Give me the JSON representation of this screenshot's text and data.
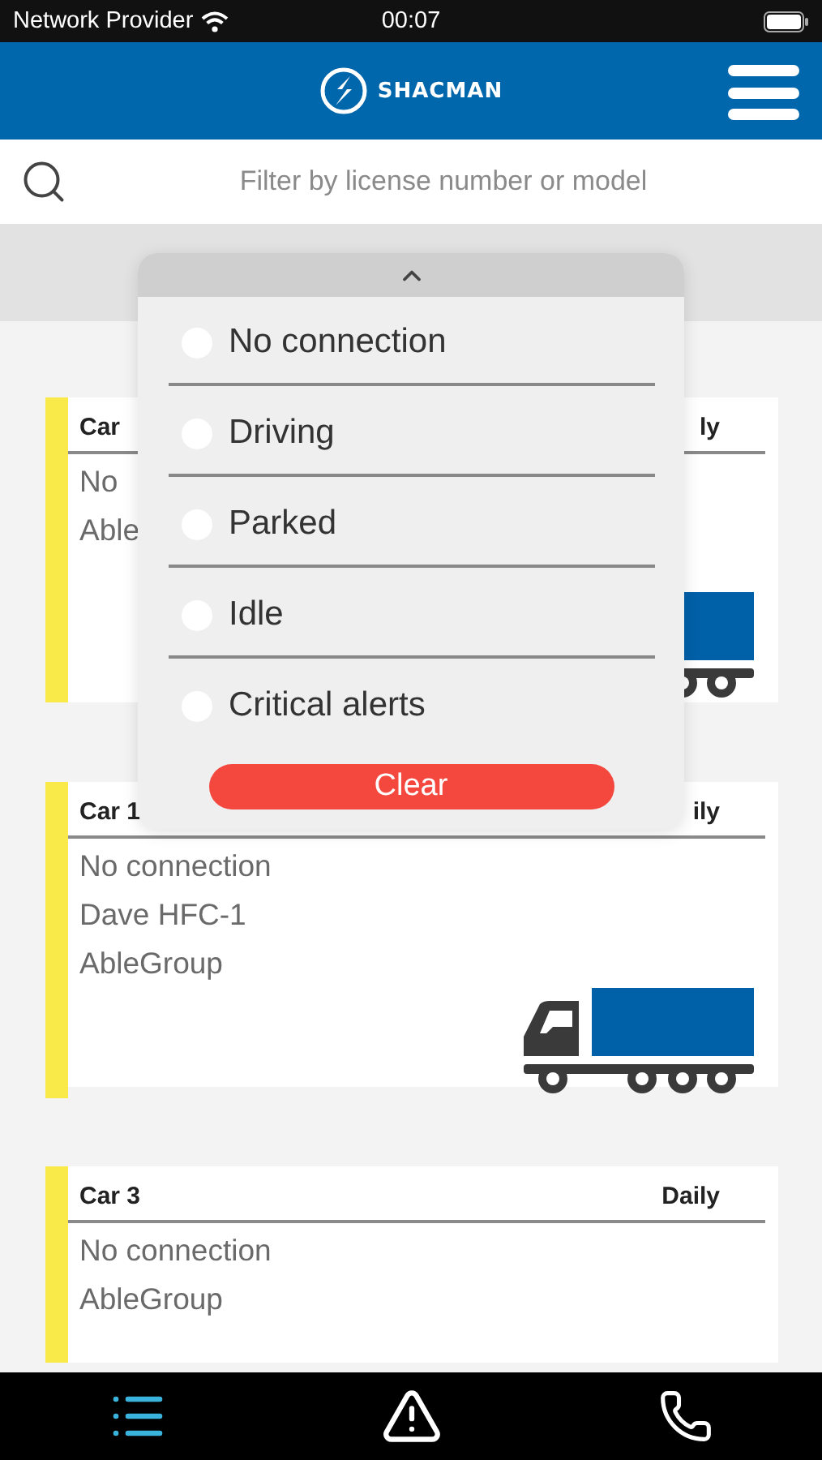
{
  "status_bar": {
    "carrier": "Network Provider",
    "time": "00:07"
  },
  "header": {
    "logo_text": "SHACMAN"
  },
  "search": {
    "placeholder": "Filter by license number or model"
  },
  "cards": [
    {
      "title": "Car",
      "period": "ly",
      "lines": [
        "No",
        "Able"
      ]
    },
    {
      "title": "Car 1",
      "period": "ily",
      "lines": [
        "No connection",
        "Dave HFC-1",
        "AbleGroup"
      ]
    },
    {
      "title": "Car 3",
      "period": "Daily",
      "lines": [
        "No connection",
        "AbleGroup"
      ]
    }
  ],
  "filter_menu": {
    "options": [
      {
        "label": "No connection",
        "selected": false
      },
      {
        "label": "Driving",
        "selected": false
      },
      {
        "label": "Parked",
        "selected": false
      },
      {
        "label": "Idle",
        "selected": false
      },
      {
        "label": "Critical alerts",
        "selected": false
      }
    ],
    "clear_label": "Clear"
  },
  "bottom_nav": [
    {
      "kind": "list",
      "selected": true
    },
    {
      "kind": "alert",
      "selected": false
    },
    {
      "kind": "phone",
      "selected": false
    }
  ]
}
